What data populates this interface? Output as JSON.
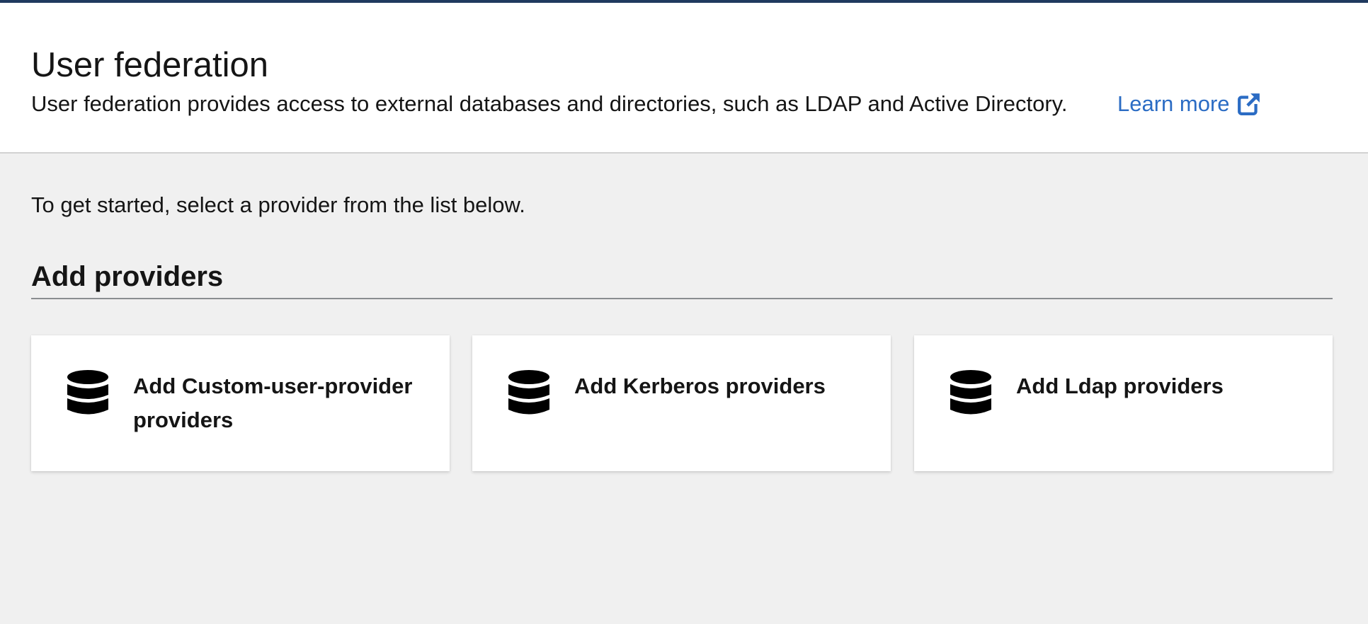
{
  "header": {
    "title": "User federation",
    "description": "User federation provides access to external databases and directories, such as LDAP and Active Directory.",
    "learn_more_label": "Learn more",
    "learn_more_icon": "external-link-icon"
  },
  "main": {
    "intro": "To get started, select a provider from the list below.",
    "section_title": "Add providers",
    "cards": [
      {
        "label": "Add Custom-user-provider providers",
        "icon": "database-icon"
      },
      {
        "label": "Add Kerberos providers",
        "icon": "database-icon"
      },
      {
        "label": "Add Ldap providers",
        "icon": "database-icon"
      }
    ]
  },
  "colors": {
    "accent_bar": "#1f3a5f",
    "link": "#2b6cc4",
    "page_background": "#f0f0f0",
    "card_background": "#ffffff"
  }
}
